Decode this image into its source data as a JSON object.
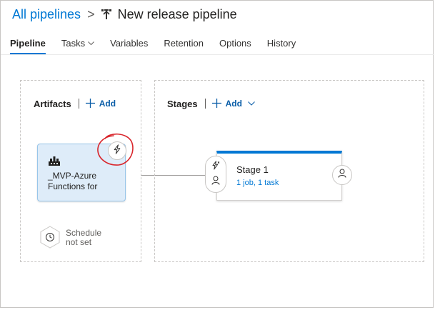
{
  "header": {
    "breadcrumb_link": "All pipelines",
    "separator": ">",
    "title": "New release pipeline",
    "icon": "pipeline-icon"
  },
  "tabs": [
    {
      "label": "Pipeline",
      "active": true
    },
    {
      "label": "Tasks",
      "dropdown": true
    },
    {
      "label": "Variables"
    },
    {
      "label": "Retention"
    },
    {
      "label": "Options"
    },
    {
      "label": "History"
    }
  ],
  "artifacts": {
    "title": "Artifacts",
    "add_label": "Add",
    "card": {
      "name_line1": "_MVP-Azure",
      "name_line2": "Functions for",
      "icon": "build-artifact-icon",
      "trigger_icon": "lightning-icon",
      "bg_color": "#deecf9"
    },
    "schedule": {
      "line1": "Schedule",
      "line2": "not set",
      "icon": "clock-icon"
    }
  },
  "stages": {
    "title": "Stages",
    "add_label": "Add",
    "stage": {
      "name": "Stage 1",
      "summary": "1 job, 1 task",
      "pre_trigger_icon": "lightning-icon",
      "pre_approver_icon": "person-icon",
      "post_approver_icon": "person-icon",
      "accent_color": "#0078d4"
    }
  },
  "colors": {
    "link": "#0078d4",
    "annotation": "#d9262c"
  }
}
